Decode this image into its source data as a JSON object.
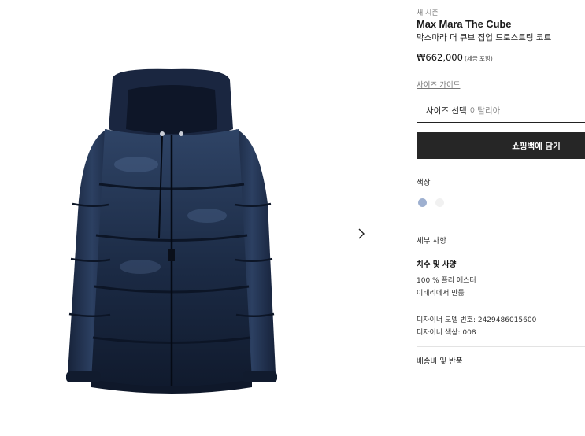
{
  "product": {
    "season": "새 시즌",
    "brand": "Max Mara The Cube",
    "name": "막스마라 더 큐브 집업 드로스트링 코트",
    "price": "₩662,000",
    "tax_note": "(세금 포함)"
  },
  "size": {
    "guide_link": "사이즈 가이드",
    "select_label": "사이즈 선택",
    "region": "이탈리아"
  },
  "actions": {
    "add_to_bag": "쇼핑백에 담기"
  },
  "color": {
    "label": "색상",
    "swatches": [
      "#9eb0d0",
      "#f1f1f1"
    ]
  },
  "details": {
    "label": "세부 사항",
    "dims_label": "치수 및 사양",
    "lines": [
      "100 % 폴리 에스터",
      "이태리에서 만듦"
    ],
    "model_number": "디자이너 모델 번호: 2429486015600",
    "designer_color": "디자이너 색상: 008"
  },
  "shipping": {
    "label": "배송비 및 반품"
  },
  "gallery": {
    "next_icon": "chevron-right-icon"
  }
}
